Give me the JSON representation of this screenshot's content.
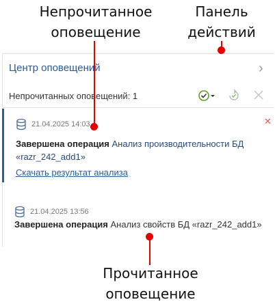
{
  "annotations": {
    "unread": "Непрочитанное оповещение",
    "panel": "Панель действий",
    "read": "Прочитанное оповещение"
  },
  "header": {
    "title": "Центр оповещений",
    "unread_count_text": "Непрочитанных оповещений: 1"
  },
  "notifications": [
    {
      "date": "21.04.2025 14:03",
      "bold": "Завершена операция",
      "text": " Анализ производительности БД «razr_242_add1»",
      "link": "Скачать результат анализа",
      "unread": true
    },
    {
      "date": "21.04.2025 13:56",
      "bold": "Завершена операция",
      "text": " Анализ свойств БД «razr_242_add1»",
      "unread": false
    }
  ],
  "colors": {
    "accent": "#2a5a9a",
    "callout": "#e00000"
  }
}
